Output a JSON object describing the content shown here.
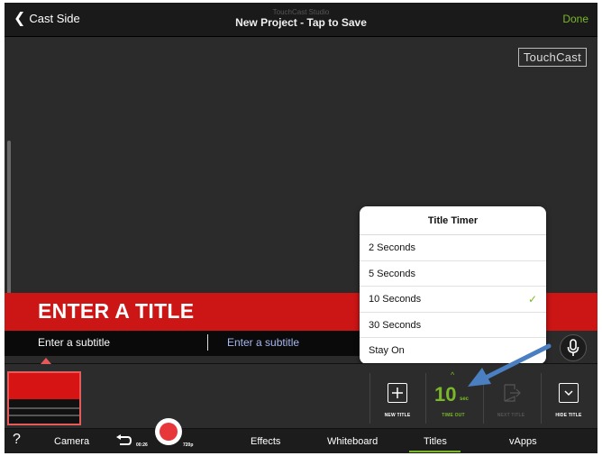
{
  "topbar": {
    "back_label": "Cast Side",
    "studio_label": "TouchCast Studio",
    "project_title": "New Project - Tap to Save",
    "done_label": "Done"
  },
  "canvas": {
    "watermark": "TouchCast",
    "title_placeholder": "ENTER A TITLE",
    "subtitle_1": "Enter a subtitle",
    "subtitle_2": "Enter a subtitle"
  },
  "timer_popup": {
    "title": "Title Timer",
    "options": [
      {
        "label": "2 Seconds",
        "selected": false
      },
      {
        "label": "5 Seconds",
        "selected": false
      },
      {
        "label": "10 Seconds",
        "selected": true
      },
      {
        "label": "30 Seconds",
        "selected": false
      },
      {
        "label": "Stay On",
        "selected": false
      }
    ],
    "check_glyph": "✓"
  },
  "toolbar": {
    "new_title_label": "NEW TITLE",
    "timeout_value": "10",
    "timeout_unit": "sec",
    "timeout_label": "TIME OUT",
    "next_title_label": "NEXT TITLE",
    "hide_title_label": "HIDE TITLE"
  },
  "tabbar": {
    "help": "?",
    "camera": "Camera",
    "rec_time": "00:26",
    "resolution": "720p",
    "effects": "Effects",
    "whiteboard": "Whiteboard",
    "titles": "Titles",
    "vapps": "vApps",
    "active_tab": "Titles"
  },
  "colors": {
    "accent": "#7ab829",
    "title_red": "#cc1515",
    "record_red": "#e8373b",
    "annotation_arrow": "#4a7fc1"
  }
}
